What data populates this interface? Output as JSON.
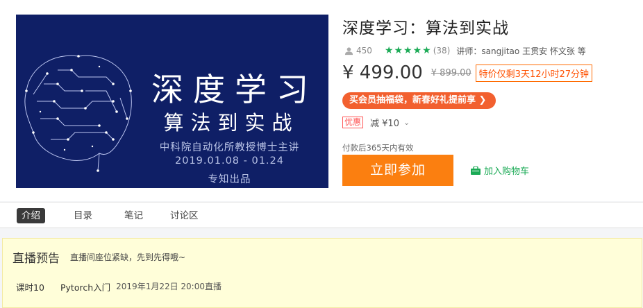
{
  "course": {
    "cover": {
      "title": "深度学习",
      "subtitle": "算法到实战",
      "line1": "中科院自动化所教授博士主讲",
      "line2": "2019.01.08 - 01.24",
      "line3": "专知出品"
    },
    "title": "深度学习：算法到实战",
    "students": "450",
    "rating": {
      "stars": 5,
      "count": "(38)"
    },
    "teachers": "讲师：sangjitao 王贯安 怀文张 等",
    "price": "¥ 499.00",
    "original_price": "¥ 899.00",
    "countdown": "特价仅剩3天12小时27分钟",
    "promo": "买会员抽福袋，新春好礼提前享 ❯",
    "coupon": {
      "tag": "优惠",
      "value": "减 ¥10",
      "chevron": "⌄"
    },
    "validity": "付款后365天内有效",
    "join_label": "立即参加",
    "cart_label": "加入购物车"
  },
  "tabs": [
    {
      "label": "介绍",
      "active": true
    },
    {
      "label": "目录",
      "active": false
    },
    {
      "label": "笔记",
      "active": false
    },
    {
      "label": "讨论区",
      "active": false
    }
  ],
  "notice": {
    "title": "直播预告",
    "subtitle": "直播间座位紧缺，先到先得哦~",
    "lesson": {
      "number": "课时10",
      "name": "Pytorch入门",
      "time": "2019年1月22日 20:00直播"
    }
  },
  "colors": {
    "accent_orange": "#fb7f10",
    "promo_red": "#f2602f",
    "star_green": "#1aaa55",
    "cover_navy": "#0f1f66",
    "notice_bg": "#fffed9"
  },
  "icons": [
    "user-icon",
    "star-icon",
    "chevron-down-icon",
    "cart-icon",
    "brain-circuit-icon"
  ]
}
